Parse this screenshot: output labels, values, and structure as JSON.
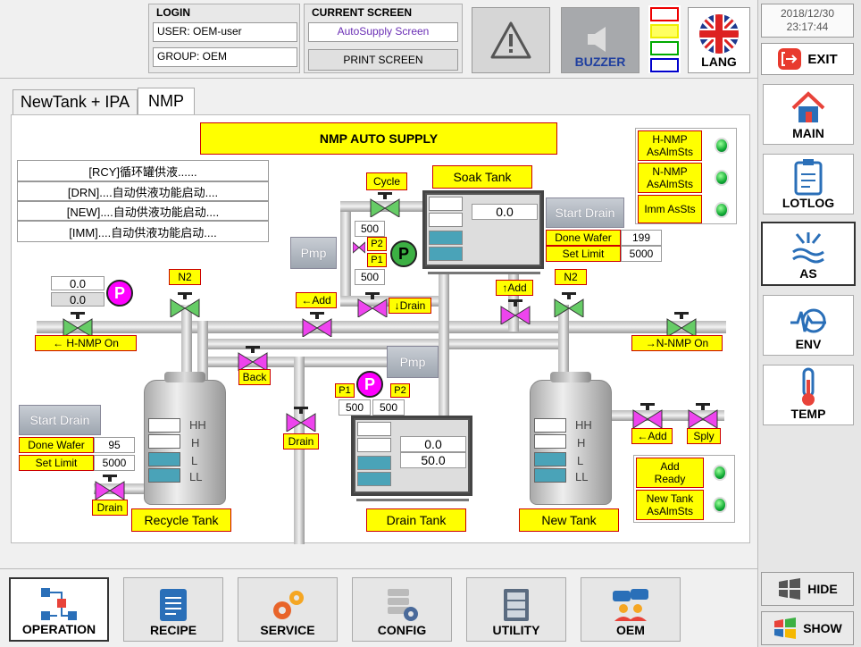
{
  "header": {
    "login_label": "LOGIN",
    "user": "USER: OEM-user",
    "group": "GROUP: OEM",
    "current_screen_label": "CURRENT SCREEN",
    "current_screen": "AutoSupply Screen",
    "print_label": "PRINT SCREEN",
    "buzzer_label": "BUZZER",
    "lang_label": "LANG",
    "date": "2018/12/30",
    "time": "23:17:44",
    "exit_label": "EXIT",
    "lamp_colors": [
      "#ff0000",
      "#ffff00",
      "#00aa00",
      "#0000cc"
    ]
  },
  "sidebar": {
    "items": [
      {
        "label": "MAIN"
      },
      {
        "label": "LOTLOG"
      },
      {
        "label": "AS"
      },
      {
        "label": "ENV"
      },
      {
        "label": "TEMP"
      }
    ],
    "hide_label": "HIDE",
    "show_label": "SHOW"
  },
  "tabs": [
    "NewTank + IPA",
    "NMP"
  ],
  "main": {
    "title": "NMP AUTO SUPPLY",
    "messages": [
      "[RCY]循环罐供液......",
      "[DRN]....自动供液功能启动....",
      "[NEW]....自动供液功能启动....",
      "[IMM]....自动供液功能启动...."
    ],
    "status": [
      {
        "label1": "H-NMP",
        "label2": "AsAlmSts"
      },
      {
        "label1": "N-NMP",
        "label2": "AsAlmSts"
      },
      {
        "label1": "Imm AsSts",
        "label2": ""
      }
    ],
    "soak_tank": {
      "title": "Soak Tank",
      "value": "0.0",
      "start_drain": "Start Drain",
      "done_wafer_label": "Done Wafer",
      "done_wafer": "199",
      "set_limit_label": "Set Limit",
      "set_limit": "5000"
    },
    "cycle_label": "Cycle",
    "pmp_label": "Pmp",
    "p1": "P1",
    "p2": "P2",
    "p1_val_top": "500",
    "p1_val_bot": "500",
    "p_letter": "P",
    "hnmp_val1": "0.0",
    "hnmp_val2": "0.0",
    "n2_label": "N2",
    "add_left": "←Add",
    "drain_down": "↓Drain",
    "add_up": "↑Add",
    "hnmp_on": "← H-NMP On",
    "nnmp_on": "→N-NMP On",
    "back_label": "Back",
    "drain_label": "Drain",
    "pump2_p1_val": "500",
    "pump2_p2_val": "500",
    "recycle": {
      "start_drain": "Start Drain",
      "done_wafer_label": "Done Wafer",
      "done_wafer": "95",
      "set_limit_label": "Set Limit",
      "set_limit": "5000",
      "title": "Recycle Tank",
      "levels": [
        "HH",
        "H",
        "L",
        "LL"
      ]
    },
    "drain_tank": {
      "title": "Drain Tank",
      "value1": "0.0",
      "value2": "50.0"
    },
    "new_tank": {
      "title": "New Tank",
      "add_label": "←Add",
      "sply_label": "Sply",
      "add_ready1": "Add",
      "add_ready2": "Ready",
      "alm1": "New Tank",
      "alm2": "AsAlmSts",
      "levels": [
        "HH",
        "H",
        "L",
        "LL"
      ]
    }
  },
  "bottom": {
    "buttons": [
      "OPERATION",
      "RECIPE",
      "SERVICE",
      "CONFIG",
      "UTILITY",
      "OEM"
    ]
  }
}
